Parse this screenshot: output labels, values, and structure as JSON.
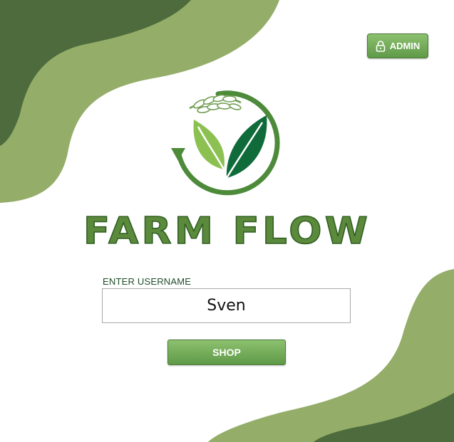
{
  "header": {
    "admin_button_label": "ADMIN",
    "admin_icon": "lock-icon"
  },
  "brand": {
    "logo_icon": "leaf-wheat-logo-icon",
    "app_title": "FARM FLOW"
  },
  "login": {
    "username_label": "ENTER USERNAME",
    "username_value": "Sven",
    "shop_button_label": "SHOP"
  },
  "colors": {
    "dark_green": "#4d6b3c",
    "light_green": "#94ad69",
    "title_green": "#5b8a3c",
    "button_green": "#6ea650"
  }
}
